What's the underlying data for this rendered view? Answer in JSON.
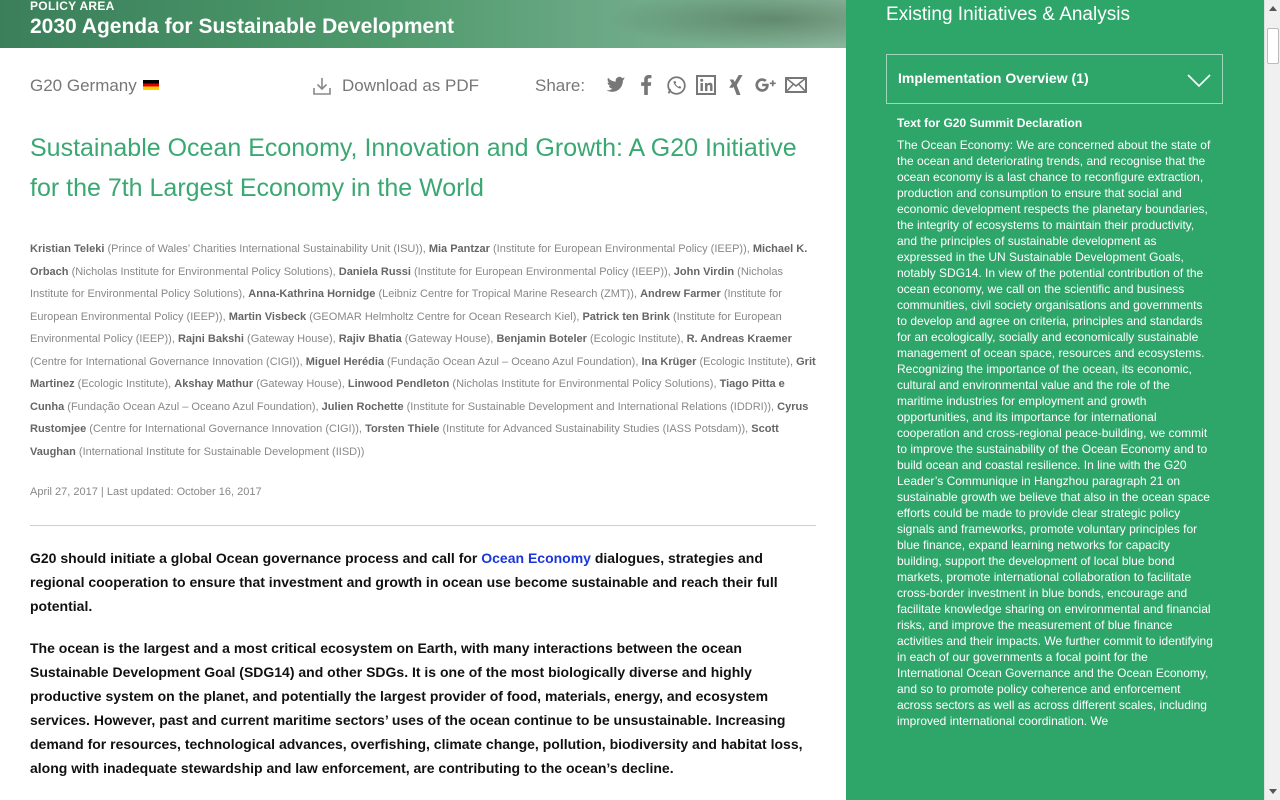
{
  "banner": {
    "eyebrow": "POLICY AREA",
    "title": "2030 Agenda for Sustainable Development"
  },
  "meta": {
    "source": "G20 Germany",
    "download_label": "Download as PDF",
    "share_label": "Share:",
    "share_icons": [
      "twitter-icon",
      "facebook-icon",
      "whatsapp-icon",
      "linkedin-icon",
      "xing-icon",
      "google-plus-icon",
      "email-icon"
    ]
  },
  "article": {
    "title": "Sustainable Ocean Economy, Innovation and Growth: A G20 Initiative for the 7th Largest Economy in the World",
    "authors": [
      {
        "name": "Kristian Teleki",
        "affil": "(Prince of Wales’ Charities International Sustainability Unit (ISU))"
      },
      {
        "name": "Mia Pantzar",
        "affil": "(Institute for European Environmental Policy (IEEP))"
      },
      {
        "name": "Michael K. Orbach",
        "affil": "(Nicholas Institute for Environmental Policy Solutions)"
      },
      {
        "name": "Daniela Russi",
        "affil": "(Institute for European Environmental Policy (IEEP))"
      },
      {
        "name": "John Virdin",
        "affil": "(Nicholas Institute for Environmental Policy Solutions)"
      },
      {
        "name": "Anna-Kathrina Hornidge",
        "affil": "(Leibniz Centre for Tropical Marine Research (ZMT))"
      },
      {
        "name": "Andrew Farmer",
        "affil": "(Institute for European Environmental Policy (IEEP))"
      },
      {
        "name": "Martin Visbeck",
        "affil": "(GEOMAR Helmholtz Centre for Ocean Research Kiel)"
      },
      {
        "name": "Patrick ten Brink",
        "affil": "(Institute for European Environmental Policy (IEEP))"
      },
      {
        "name": "Rajni Bakshi",
        "affil": "(Gateway House)"
      },
      {
        "name": "Rajiv Bhatia",
        "affil": "(Gateway House)"
      },
      {
        "name": "Benjamin Boteler",
        "affil": "(Ecologic Institute)"
      },
      {
        "name": "R. Andreas Kraemer",
        "affil": "(Centre for International Governance Innovation (CIGI))"
      },
      {
        "name": "Miguel Herédia",
        "affil": "(Fundação Ocean Azul – Oceano Azul Foundation)"
      },
      {
        "name": "Ina Krüger",
        "affil": "(Ecologic Institute)"
      },
      {
        "name": "Grit Martinez",
        "affil": "(Ecologic Institute)"
      },
      {
        "name": "Akshay Mathur",
        "affil": "(Gateway House)"
      },
      {
        "name": "Linwood Pendleton",
        "affil": "(Nicholas Institute for Environmental Policy Solutions)"
      },
      {
        "name": "Tiago Pitta e Cunha",
        "affil": "(Fundação Ocean Azul – Oceano Azul Foundation)"
      },
      {
        "name": "Julien Rochette",
        "affil": "(Institute for Sustainable Development and International Relations (IDDRI))"
      },
      {
        "name": "Cyrus Rustomjee",
        "affil": "(Centre for International Governance Innovation (CIGI))"
      },
      {
        "name": "Torsten Thiele",
        "affil": "(Institute for Advanced Sustainability Studies (IASS Potsdam))"
      },
      {
        "name": "Scott Vaughan",
        "affil": "(International Institute for Sustainable Development (IISD))"
      }
    ],
    "dates": "April 27, 2017 | Last updated: October 16, 2017",
    "lead_before": "G20 should initiate a global Ocean governance process and call for ",
    "lead_link": "Ocean Economy",
    "lead_after": " dialogues, strategies and regional cooperation to ensure that investment and growth in ocean use become sustainable and reach their full potential.",
    "paragraph": "The ocean is the largest and a most critical ecosystem on Earth, with many interactions between the ocean Sustainable Development Goal (SDG14) and other SDGs. It is one of the most biologically diverse and highly productive system on the planet, and potentially the largest provider of food, materials, energy, and ecosystem services. However, past and current maritime sectors’ uses of the ocean continue to be unsustainable. Increasing demand for resources, technological advances, overfishing, climate change, pollution, biodiversity and habitat loss, along with inadequate stewardship and law enforcement, are contributing to the ocean’s decline."
  },
  "sidebar": {
    "title": "Existing Initiatives & Analysis",
    "accordion_label": "Implementation Overview (1)",
    "panel_heading": "Text for G20 Summit Declaration",
    "panel_text": "The Ocean Economy: We are concerned about the state of the ocean and deteriorating trends, and recognise that the ocean economy is a last chance to reconfigure extraction, production and consumption to ensure that social and economic development respects the planetary boundaries, the integrity of ecosystems to maintain their productivity, and the principles of sustainable development as expressed in the UN Sustainable Development Goals, notably SDG14. In view of the potential contribution of the ocean economy, we call on the scientific and business communities, civil society organisations and governments to develop and agree on criteria, principles and standards for an ecologically, socially and economically sustainable management of ocean space, resources and ecosystems. Recognizing the importance of the ocean, its economic, cultural and environmental value and the role of the maritime industries for employment and growth opportunities, and its importance for international cooperation and cross-regional peace-building, we commit to improve the sustainability of the Ocean Economy and to build ocean and coastal resilience. In line with the G20 Leader’s Communique in Hangzhou paragraph 21 on sustainable growth we believe that also in the ocean space efforts could be made to provide clear strategic policy signals and frameworks, promote voluntary principles for blue finance, expand learning networks for capacity building, support the development of local blue bond markets, promote international collaboration to facilitate cross-border investment in blue bonds, encourage and facilitate knowledge sharing on environmental and financial risks, and improve the measurement of blue finance activities and their impacts. We further commit to identifying in each of our governments a focal point for the International Ocean Governance and the Ocean Economy, and so to promote policy coherence and enforcement across sectors as well as across different scales, including improved international coordination. We"
  },
  "colors": {
    "accent_green": "#3aa872",
    "sidebar_green": "#2ea66a",
    "link_blue": "#1a36d9"
  }
}
